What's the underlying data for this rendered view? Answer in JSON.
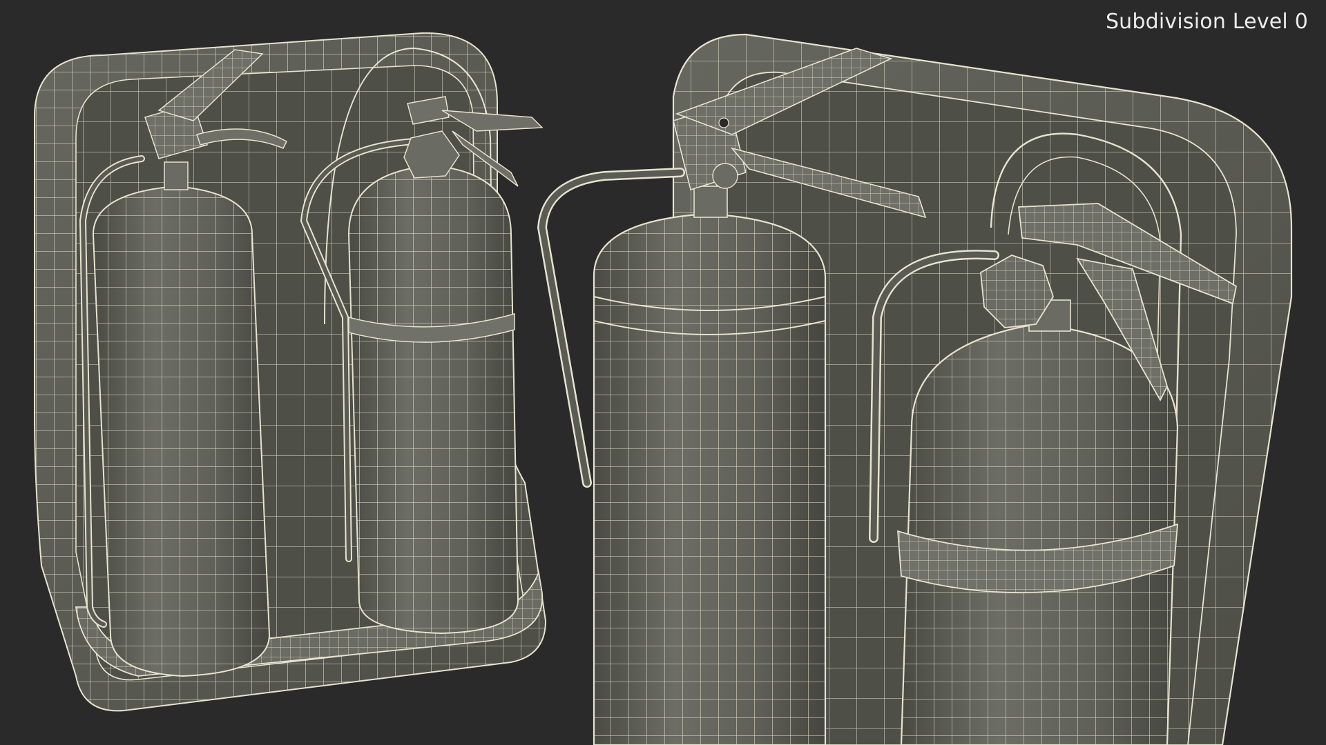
{
  "viewport": {
    "label": "Subdivision Level 0",
    "colors": {
      "background": "#2a2a2a",
      "surface": "#5e5f57",
      "surface_shadow": "#46473f",
      "surface_highlight": "#75766d",
      "wire": "#e6e3cf"
    }
  },
  "scene": {
    "subject": "fire extinguisher stand with two extinguishers",
    "views": [
      "overview",
      "close-up"
    ]
  }
}
